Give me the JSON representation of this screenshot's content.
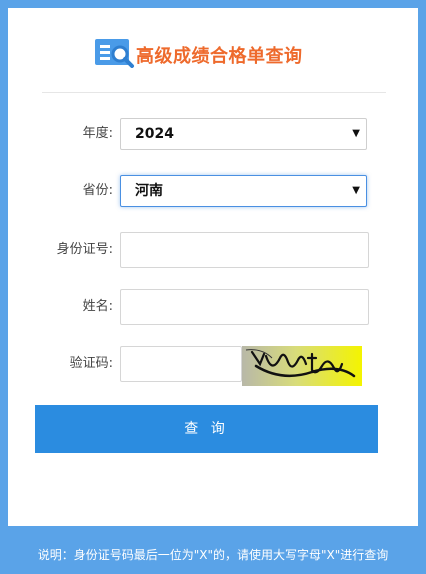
{
  "header": {
    "title": "高级成绩合格单查询"
  },
  "form": {
    "year": {
      "label": "年度:",
      "value": "2024"
    },
    "province": {
      "label": "省份:",
      "value": "河南"
    },
    "id_number": {
      "label": "身份证号:",
      "value": ""
    },
    "name": {
      "label": "姓名:",
      "value": ""
    },
    "captcha": {
      "label": "验证码:",
      "value": ""
    }
  },
  "actions": {
    "query_label": "查 询"
  },
  "footer": {
    "note": "说明：身份证号码最后一位为\"X\"的，请使用大写字母\"X\"进行查询"
  },
  "colors": {
    "background": "#5aa3e8",
    "title": "#ee6a2c",
    "button": "#2b8ce0",
    "logo": "#4a9be8"
  }
}
